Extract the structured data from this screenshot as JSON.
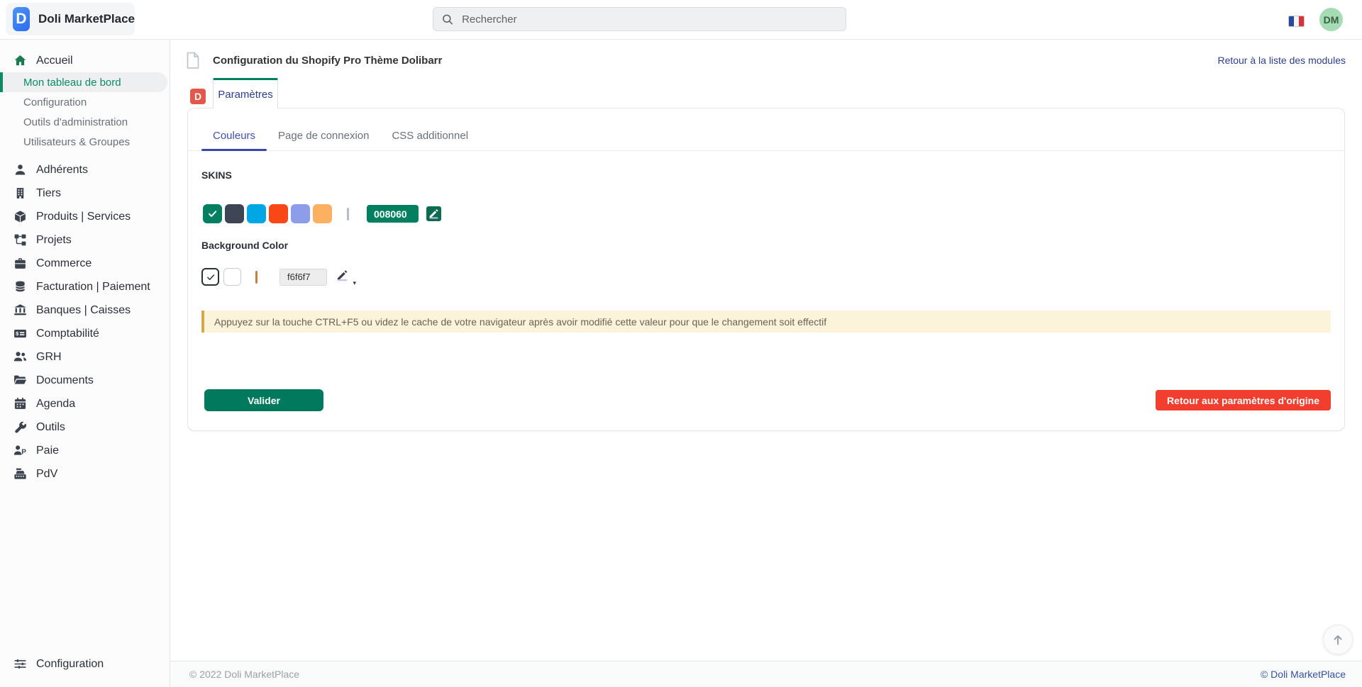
{
  "header": {
    "app_title": "Doli MarketPlace",
    "logo_letter": "D",
    "search_placeholder": "Rechercher",
    "language_flag": "french-flag-icon",
    "avatar_initials": "DM"
  },
  "sidebar": {
    "home": {
      "icon": "home-icon",
      "label": "Accueil"
    },
    "home_children": [
      {
        "label": "Mon tableau de bord",
        "active": true
      },
      {
        "label": "Configuration",
        "active": false
      },
      {
        "label": "Outils d'administration",
        "active": false
      },
      {
        "label": "Utilisateurs & Groupes",
        "active": false
      }
    ],
    "items": [
      {
        "icon": "user-icon",
        "label": "Adhérents"
      },
      {
        "icon": "building-icon",
        "label": "Tiers"
      },
      {
        "icon": "cube-icon",
        "label": "Produits | Services"
      },
      {
        "icon": "sitemap-icon",
        "label": "Projets"
      },
      {
        "icon": "briefcase-icon",
        "label": "Commerce"
      },
      {
        "icon": "coins-icon",
        "label": "Facturation | Paiement"
      },
      {
        "icon": "bank-icon",
        "label": "Banques | Caisses"
      },
      {
        "icon": "money-check-icon",
        "label": "Comptabilité"
      },
      {
        "icon": "users-icon",
        "label": "GRH"
      },
      {
        "icon": "folder-open-icon",
        "label": "Documents"
      },
      {
        "icon": "calendar-icon",
        "label": "Agenda"
      },
      {
        "icon": "wrench-icon",
        "label": "Outils"
      },
      {
        "icon": "payroll-icon",
        "label": "Paie"
      },
      {
        "icon": "cash-register-icon",
        "label": "PdV"
      }
    ],
    "bottom_item": {
      "icon": "sliders-icon",
      "label": "Configuration"
    }
  },
  "page": {
    "title": "Configuration du Shopify Pro Thème Dolibarr",
    "title_icon": "document-icon",
    "back_link": "Retour à la liste des modules",
    "module_badge_letter": "D",
    "tab_label": "Paramètres",
    "subtabs": [
      {
        "label": "Couleurs",
        "active": true
      },
      {
        "label": "Page de connexion",
        "active": false
      },
      {
        "label": "CSS additionnel",
        "active": false
      }
    ]
  },
  "settings": {
    "skins_label": "SKINS",
    "skin_colors": [
      "#008060",
      "#3e4555",
      "#00a7e5",
      "#f94718",
      "#8e9de9",
      "#fbb161"
    ],
    "selected_skin_index": 0,
    "skin_hex_value": "008060",
    "background_label": "Background Color",
    "background_swatches": [
      "#ffffff",
      "#ffffff"
    ],
    "selected_background_index": 0,
    "background_hex_value": "f6f6f7",
    "warning_text": "Appuyez sur la touche CTRL+F5 ou videz le cache de votre navigateur après avoir modifié cette valeur pour que le changement soit effectif",
    "submit_label": "Valider",
    "reset_label": "Retour aux paramètres d'origine"
  },
  "footer": {
    "left": "© 2022 Doli MarketPlace",
    "right": "© Doli MarketPlace"
  },
  "colors": {
    "brand_green": "#008060",
    "sidebar_active_green": "#0d8a62",
    "tab_top_border": "#008060",
    "subtab_active_indigo": "#3f51b5",
    "link_navy": "#2c3e8f",
    "danger_red": "#f23e2e",
    "badge_red": "#e4584b",
    "warning_bg": "#fbf4da",
    "warning_border": "#d2a94b",
    "avatar_bg": "#a5dcb3"
  }
}
